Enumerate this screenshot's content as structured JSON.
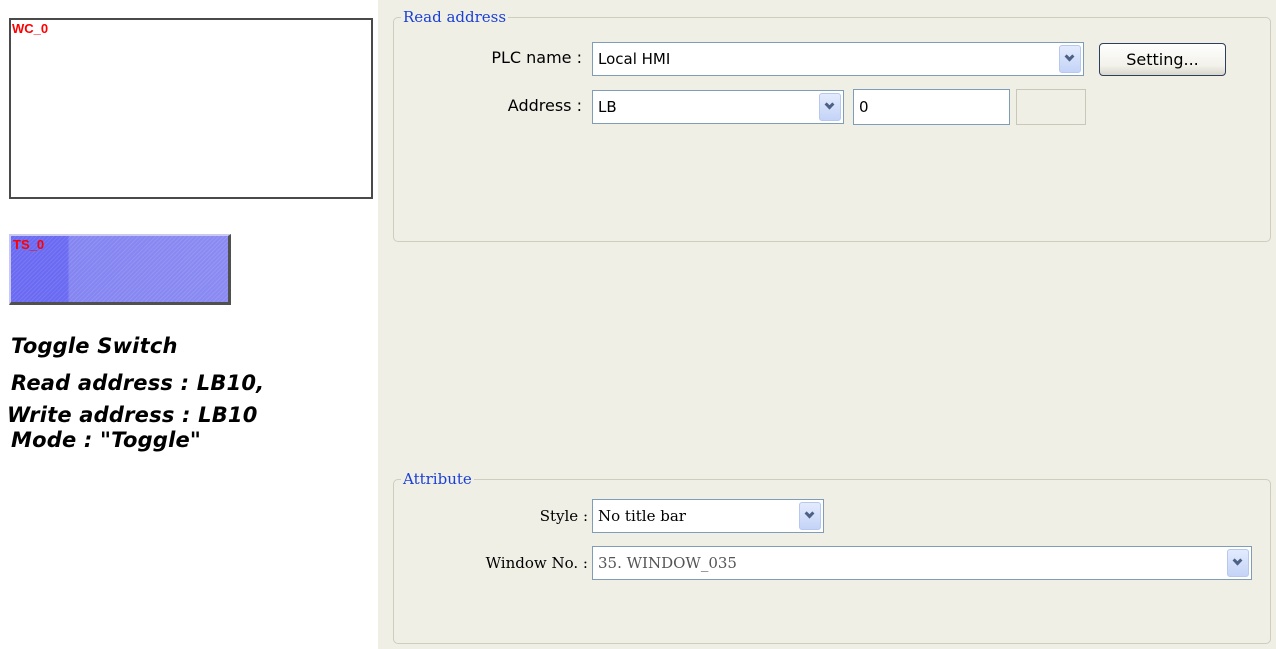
{
  "canvas": {
    "window_control_label": "WC_0",
    "toggle_switch_label": "TS_0",
    "description": {
      "line1": "Toggle Switch",
      "line2": "Read address : LB10,",
      "line3": "Write address : LB10",
      "line4": "Mode : \"Toggle\""
    }
  },
  "read_address": {
    "title": "Read address",
    "plc_name_label": "PLC name :",
    "plc_name_value": "Local HMI",
    "setting_button": "Setting...",
    "address_label": "Address :",
    "address_type": "LB",
    "address_value": "0"
  },
  "attribute": {
    "title": "Attribute",
    "style_label": "Style :",
    "style_value": "No title bar",
    "window_no_label": "Window No. :",
    "window_no_value": "35. WINDOW_035"
  },
  "colors": {
    "group_title": "#1a3fd6",
    "object_label": "#ff0000",
    "toggle_fill": "#7a7af2",
    "panel_bg": "#f0efe6"
  }
}
